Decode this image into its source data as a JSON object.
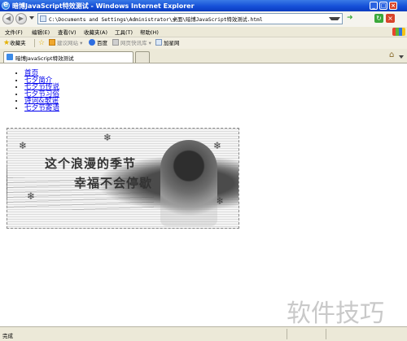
{
  "window": {
    "title": "暗博JavaScript特效测试 - Windows Internet Explorer",
    "buttons": [
      "_",
      "□",
      "×"
    ]
  },
  "address_bar": {
    "url": "C:\\Documents and Settings\\Administrator\\桌面\\暗博JavaScript特效测试.html"
  },
  "menu": {
    "items": [
      "文件(F)",
      "编辑(E)",
      "查看(V)",
      "收藏夹(A)",
      "工具(T)",
      "帮助(H)"
    ]
  },
  "favorites": {
    "label": "收藏夹",
    "items": [
      "建议网站 ▾",
      "百度",
      "网页快讯库 ▾",
      "加星网"
    ]
  },
  "tabs": {
    "active_label": "暗博JavaScript特效测试"
  },
  "page": {
    "nav_links": [
      "首页",
      "七夕简介",
      "七夕节传说",
      "七夕节习俗",
      "诗词&歌谣",
      "七夕节寄语"
    ],
    "banner": {
      "line1": "这个浪漫的季节",
      "line2": "幸福不会停歇"
    }
  },
  "status": {
    "text": "完成"
  },
  "watermark": "软件技巧"
}
